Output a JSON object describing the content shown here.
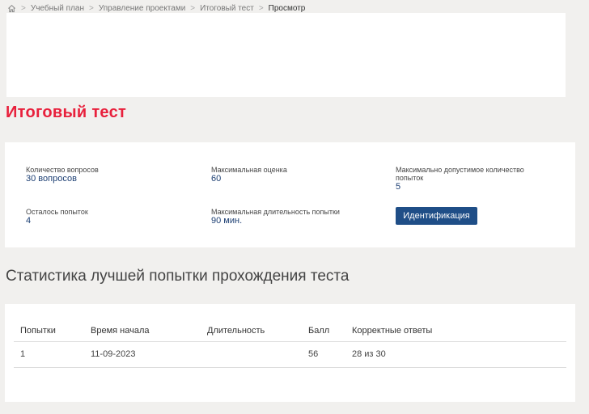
{
  "breadcrumb": {
    "home_icon": "home-icon",
    "items": [
      "Учебный план",
      "Управление проектами",
      "Итоговый тест"
    ],
    "current": "Просмотр"
  },
  "page_title": "Итоговый тест",
  "info": {
    "questions_label": "Количество вопросов",
    "questions_value": "30 вопросов",
    "max_score_label": "Максимальная оценка",
    "max_score_value": "60",
    "max_attempts_label": "Максимально допустимое количество попыток",
    "max_attempts_value": "5",
    "attempts_left_label": "Осталось попыток",
    "attempts_left_value": "4",
    "max_duration_label": "Максимальная длительность попытки",
    "max_duration_value": "90 мин.",
    "identify_button": "Идентификация"
  },
  "stats_title": "Статистика лучшей попытки прохождения теста",
  "stats_table": {
    "headers": [
      "Попытки",
      "Время начала",
      "Длительность",
      "Балл",
      "Корректные ответы"
    ],
    "rows": [
      [
        "1",
        "11-09-2023",
        "",
        "56",
        "28 из 30"
      ]
    ]
  },
  "colors": {
    "accent": "#e8203c",
    "value": "#1d3f73",
    "button": "#1f4e87",
    "background": "#f1f0ee"
  }
}
